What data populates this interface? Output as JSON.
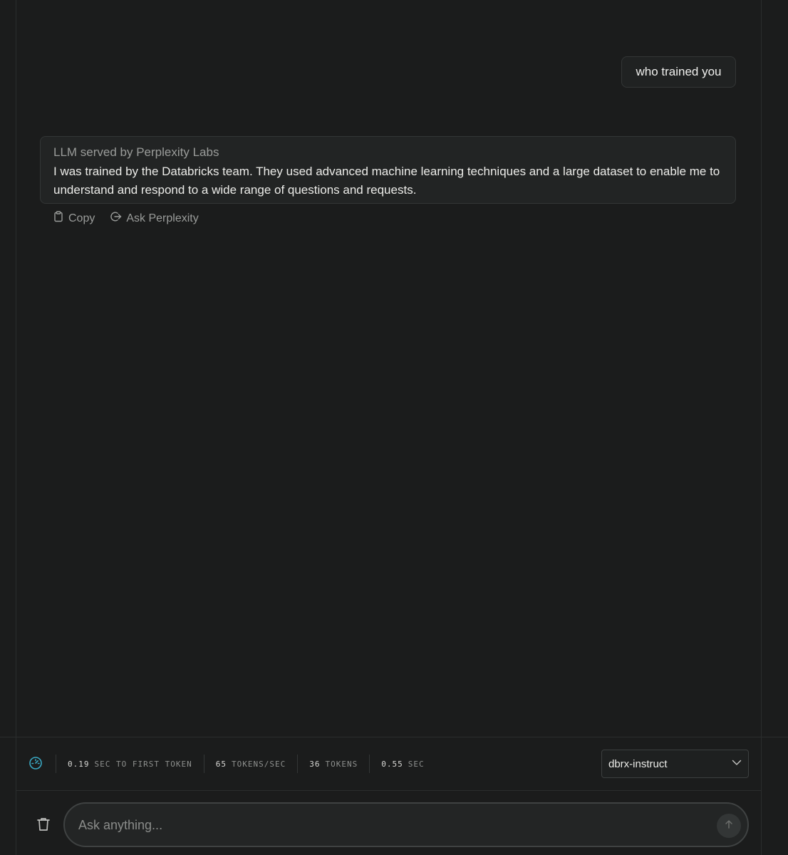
{
  "conversation": {
    "user_message": "who trained you",
    "answer": {
      "source": "LLM served by Perplexity Labs",
      "text": "I was trained by the Databricks team. They used advanced machine learning techniques and a large dataset to enable me to understand and respond to a wide range of questions and requests."
    },
    "actions": {
      "copy_label": "Copy",
      "ask_label": "Ask Perplexity"
    }
  },
  "stats": {
    "first_token": {
      "value": "0.19",
      "label": "SEC TO FIRST TOKEN"
    },
    "tokens_per_sec": {
      "value": "65",
      "label": "TOKENS/SEC"
    },
    "tokens": {
      "value": "36",
      "label": "TOKENS"
    },
    "total_time": {
      "value": "0.55",
      "label": "SEC"
    }
  },
  "model_select": {
    "selected": "dbrx-instruct"
  },
  "composer": {
    "placeholder": "Ask anything..."
  },
  "colors": {
    "background": "#1b1c1c",
    "accent": "#3aa9c4"
  },
  "icons": {
    "copy": "clipboard-icon",
    "ask": "arrow-circle-icon",
    "gauge": "speed-gauge-icon",
    "dropdown": "chevron-down-icon",
    "clear": "trash-icon",
    "send": "arrow-up-icon"
  }
}
